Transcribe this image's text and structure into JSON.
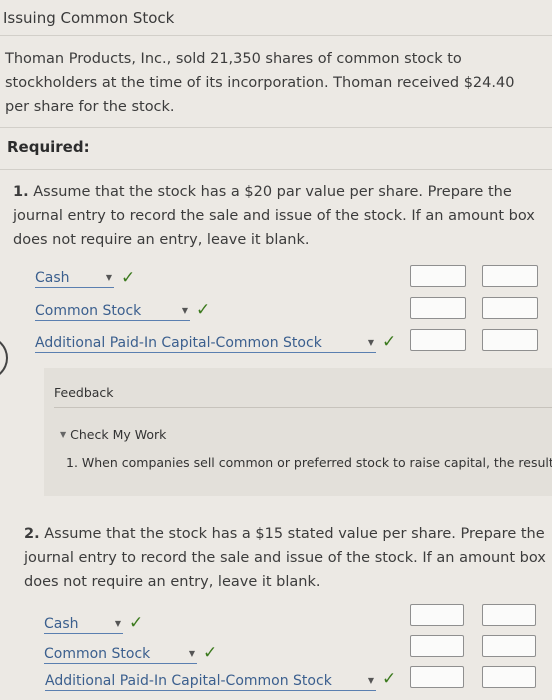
{
  "header": {
    "title": "Issuing Common Stock"
  },
  "problem": {
    "lines": [
      "Thoman Products, Inc., sold 21,350 shares of common stock to",
      "stockholders at the time of its incorporation. Thoman received $24.40",
      "per share for the stock."
    ],
    "required_label": "Required:"
  },
  "q1": {
    "number": "1.",
    "lines": [
      "Assume that the stock has a $20 par value per share. Prepare the",
      "journal entry to record the sale and issue of the stock. If an amount box",
      "does not require an entry, leave it blank."
    ],
    "accounts": [
      "Cash",
      "Common Stock",
      "Additional Paid-In Capital-Common Stock"
    ]
  },
  "feedback": {
    "title": "Feedback",
    "check_my_work": "Check My Work",
    "text": "1. When companies sell common or preferred stock to raise capital, the resulti"
  },
  "q2": {
    "number": "2.",
    "lines": [
      "Assume that the stock has a $15 stated value per share. Prepare the",
      "journal entry to record the sale and issue of the stock. If an amount box",
      "does not require an entry, leave it blank."
    ],
    "accounts": [
      "Cash",
      "Common Stock",
      "Additional Paid-In Capital-Common Stock"
    ]
  },
  "icons": {
    "checkmark": "✓",
    "dropdown": "▼",
    "collapse": "▼"
  },
  "colors": {
    "check": "#3c7a1e",
    "link": "#3b5f8e",
    "underline": "#5a7fb0"
  }
}
